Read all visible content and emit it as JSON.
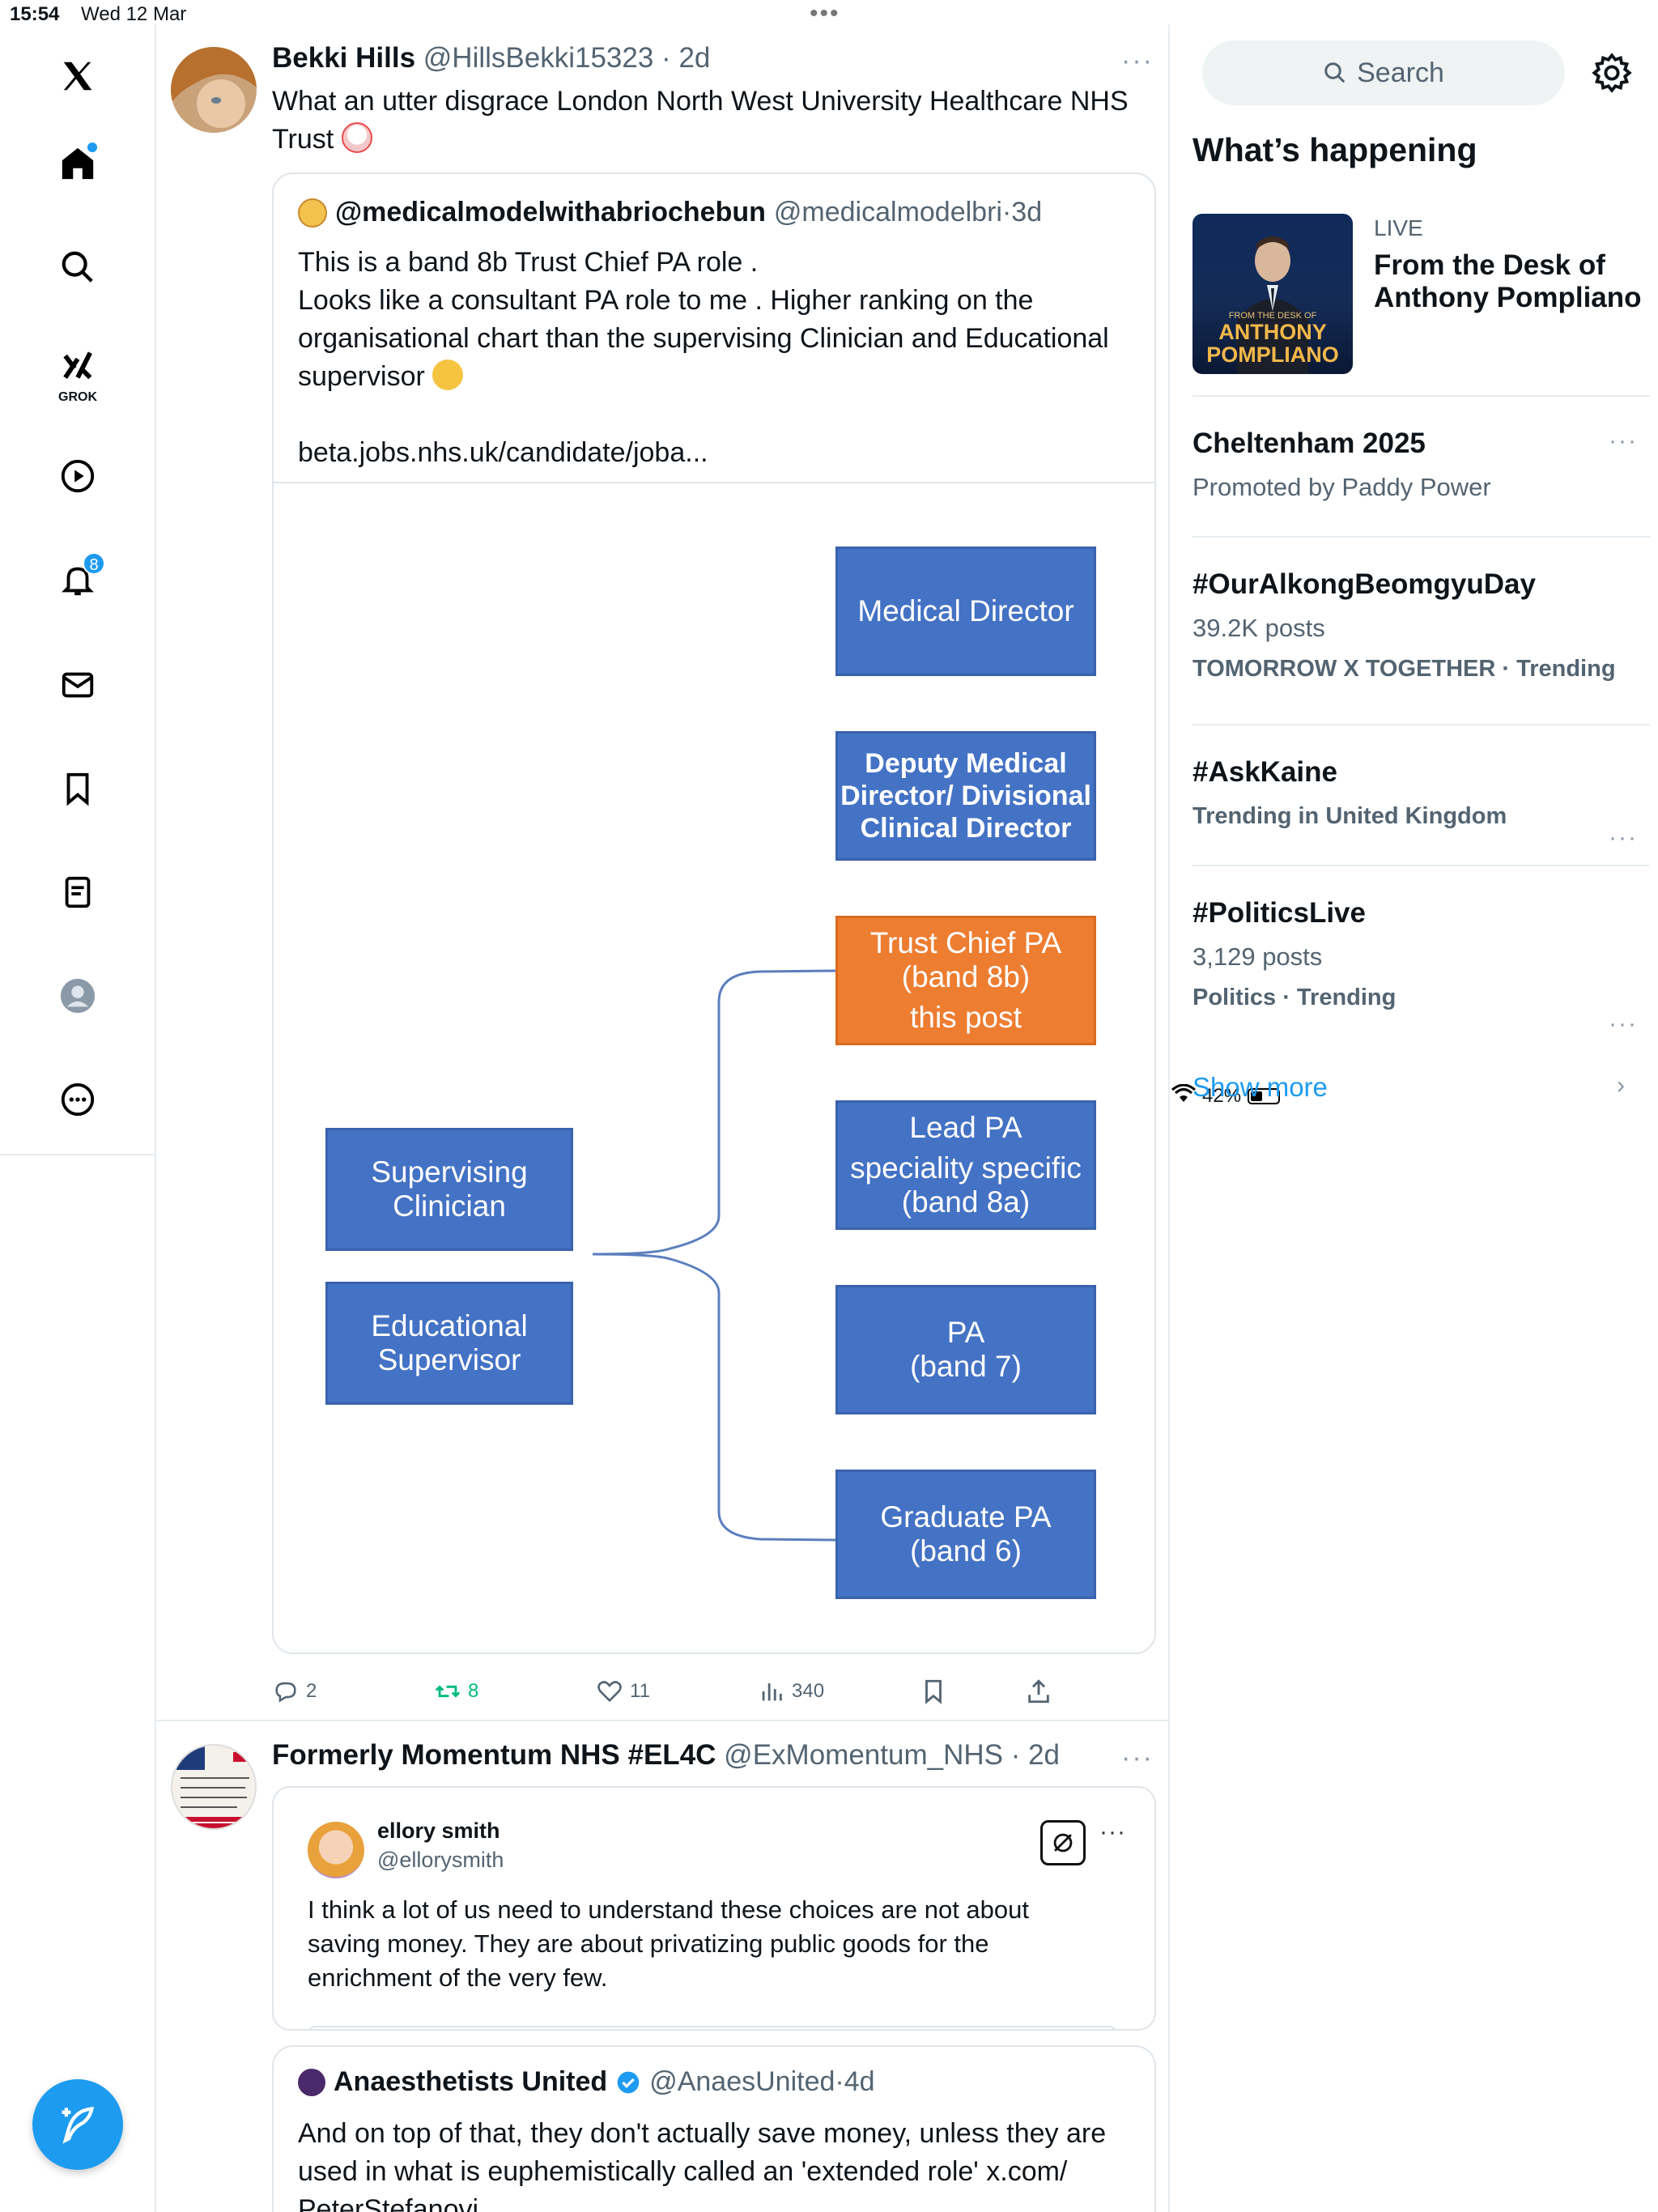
{
  "status_bar": {
    "time": "15:54",
    "date": "Wed 12 Mar",
    "battery": "42%"
  },
  "nav": {
    "grok_label": "GROK",
    "notifications_badge": "8"
  },
  "tweet1": {
    "author_name": "Bekki Hills",
    "author_handle": "@HillsBekki15323",
    "time": "2d",
    "text_line1": "What an utter disgrace London North West University Healthcare NHS",
    "text_line2": "Trust",
    "quote": {
      "author_name": "@medicalmodelwithabriochebun",
      "author_handle": "@medicalmodelbri",
      "time": "3d",
      "line1": "This is a band 8b Trust Chief PA role .",
      "line2": "Looks like a consultant PA role to me . Higher ranking on the",
      "line3": "organisational chart than the supervising Clinician and Educational",
      "line4": "supervisor",
      "link": "beta.jobs.nhs.uk/candidate/joba..."
    },
    "org_chart": {
      "medical_director": "Medical Director",
      "deputy_1": "Deputy Medical",
      "deputy_2": "Director/ Divisional",
      "deputy_3": "Clinical Director",
      "trust_chief_1": "Trust Chief PA",
      "trust_chief_2": "(band 8b)",
      "trust_chief_3": "this post",
      "lead_1": "Lead PA",
      "lead_2": "speciality specific",
      "lead_3": "(band 8a)",
      "pa_1": "PA",
      "pa_2": "(band 7)",
      "grad_1": "Graduate PA",
      "grad_2": "(band 6)",
      "sup_clin_1": "Supervising",
      "sup_clin_2": "Clinician",
      "edu_sup_1": "Educational",
      "edu_sup_2": "Supervisor"
    },
    "stats": {
      "replies": "2",
      "reposts": "8",
      "likes": "11",
      "views": "340"
    }
  },
  "tweet2": {
    "author_name": "Formerly Momentum NHS #EL4C",
    "author_handle": "@ExMomentum_NHS",
    "time": "2d",
    "card": {
      "name": "ellory smith",
      "handle": "@ellorysmith",
      "line1": "I think a lot of us need to understand these choices are not about",
      "line2": "saving money. They are about privatizing public goods for the",
      "line3": "enrichment of the very few."
    },
    "quote": {
      "author_name": "Anaesthetists United",
      "author_handle": "@AnaesUnited",
      "time": "4d",
      "line1": "And on top of that, they don't actually save money, unless they are",
      "line2": "used in what is euphemistically called an 'extended role' x.com/",
      "line3": "PeterStefanovi..."
    }
  },
  "sidebar": {
    "search_placeholder": "Search",
    "whats_happening": "What’s happening",
    "live_label": "LIVE",
    "live_title": "From the Desk of Anthony Pompliano",
    "live_thumb_top": "FROM THE DESK OF",
    "live_thumb_name1": "ANTHONY",
    "live_thumb_name2": "POMPLIANO",
    "trends": [
      {
        "title": "Cheltenham 2025",
        "sub": "Promoted by Paddy Power",
        "meta": ""
      },
      {
        "title": "#OurAlkongBeomgyuDay",
        "sub": "39.2K posts",
        "meta": "TOMORROW X TOGETHER · Trending"
      },
      {
        "title": "#AskKaine",
        "sub": "",
        "meta": "Trending in United Kingdom"
      },
      {
        "title": "#PoliticsLive",
        "sub": "3,129 posts",
        "meta": "Politics · Trending"
      }
    ],
    "show_more": "Show more"
  },
  "colors": {
    "accent": "#1d9bf0",
    "chart_blue": "#4472c4",
    "chart_orange": "#ed7d31",
    "repost_green": "#00ba7c"
  }
}
